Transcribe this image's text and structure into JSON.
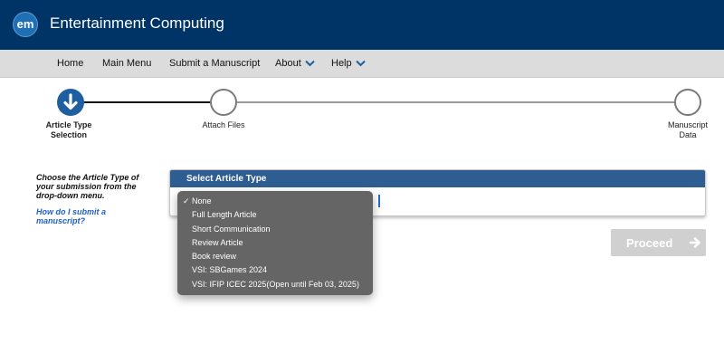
{
  "app": {
    "logo_text": "em",
    "title": "Entertainment Computing"
  },
  "nav": {
    "home": "Home",
    "main_menu": "Main Menu",
    "submit": "Submit a Manuscript",
    "about": "About",
    "help": "Help"
  },
  "stepper": {
    "steps": [
      {
        "label_line1": "Article Type",
        "label_line2": "Selection",
        "state": "active"
      },
      {
        "label_line1": "Attach Files",
        "label_line2": "",
        "state": "inactive"
      },
      {
        "label_line1": "Manuscript",
        "label_line2": "Data",
        "state": "inactive"
      }
    ]
  },
  "instructions": {
    "text": "Choose the Article Type of your submission from the drop-down menu.",
    "help_link": "How do I submit a manuscript?"
  },
  "panel": {
    "header": "Select Article Type"
  },
  "dropdown": {
    "selected_mark": "✓",
    "options": [
      {
        "label": "None",
        "selected": true
      },
      {
        "label": "Full Length Article",
        "selected": false
      },
      {
        "label": "Short Communication",
        "selected": false
      },
      {
        "label": "Review Article",
        "selected": false
      },
      {
        "label": "Book review",
        "selected": false
      },
      {
        "label": "VSI: SBGames 2024",
        "selected": false
      },
      {
        "label": "VSI: IFIP ICEC 2025(Open until Feb 03, 2025)",
        "selected": false
      }
    ]
  },
  "proceed": {
    "label": "Proceed",
    "icon": "arrow-right-icon",
    "enabled": false
  },
  "colors": {
    "topbar": "#003366",
    "accent": "#2e5d92",
    "step_active": "#1f5f9f",
    "link": "#1f5fcc"
  }
}
